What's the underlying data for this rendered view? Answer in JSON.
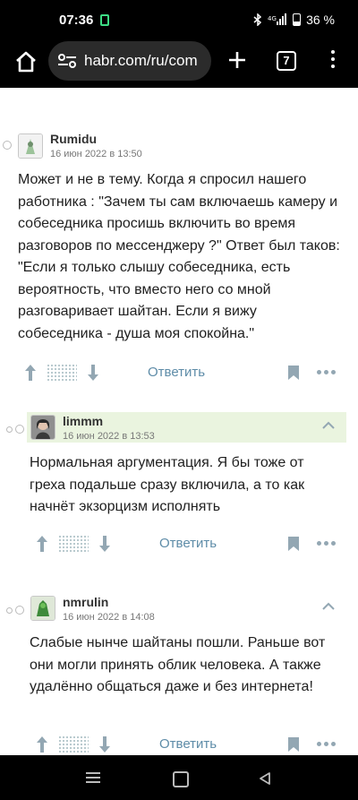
{
  "status": {
    "time": "07:36",
    "battery": "36 %"
  },
  "browser": {
    "url": "habr.com/ru/com",
    "tab_count": "7"
  },
  "comments": [
    {
      "author": "Rumidu",
      "date": "16 июн 2022 в 13:50",
      "text": "Может и не в тему. Когда я спросил нашего работника : \"Зачем ты сам включаешь камеру и собеседника просишь включить во время разговоров по мессенджеру ?\" Ответ был таков: \"Если я только слышу собеседника, есть вероятность, что вместо него со мной разговаривает шайтан. Если я вижу собеседника - душа моя спокойна.\"",
      "reply_label": "Ответить"
    },
    {
      "author": "limmm",
      "date": "16 июн 2022 в 13:53",
      "text": "Нормальная аргументация. Я бы тоже от греха подальше сразу включила, а то как начнёт экзорцизм исполнять",
      "reply_label": "Ответить"
    },
    {
      "author": "nmrulin",
      "date": "16 июн 2022 в 14:08",
      "text": "Слабые нынче шайтаны пошли. Раньше вот они могли принять облик человека. А также удалённо общаться даже и без интернета!",
      "reply_label": "Ответить"
    }
  ]
}
